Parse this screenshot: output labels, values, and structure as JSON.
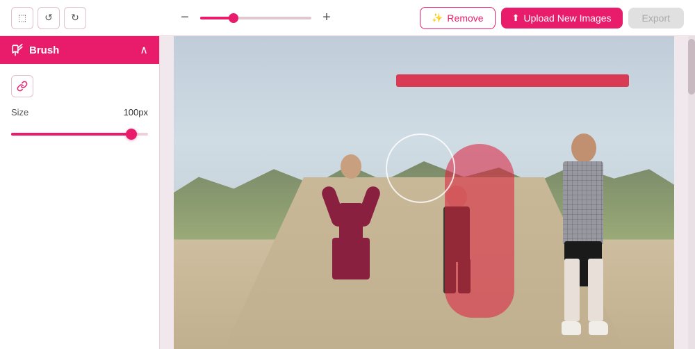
{
  "toolbar": {
    "undo_label": "↺",
    "redo_label": "↻",
    "zoom_minus": "−",
    "zoom_plus": "+",
    "zoom_value": 30,
    "remove_label": "Remove",
    "upload_label": "Upload New Images",
    "export_label": "Export"
  },
  "sidebar": {
    "brush_panel": {
      "title": "Brush",
      "collapse_icon": "chevron-up",
      "link_icon": "link",
      "size_label": "Size",
      "size_value": "100px"
    }
  },
  "canvas": {
    "alt": "Photo editing canvas with outdoor scene"
  },
  "icons": {
    "frame": "⬚",
    "undo": "↺",
    "redo": "↻",
    "brush": "✏",
    "link": "🔗",
    "wand": "✨",
    "upload": "⬆",
    "chevron_up": "∧"
  }
}
